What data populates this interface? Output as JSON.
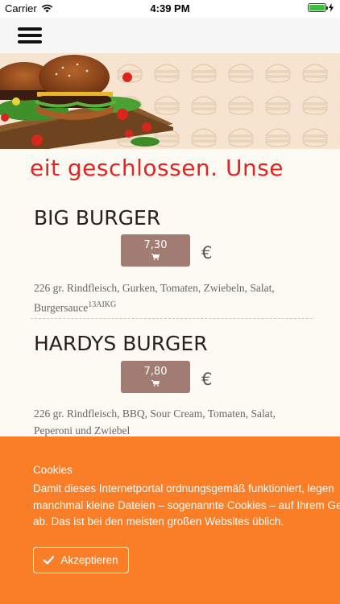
{
  "status_bar": {
    "carrier": "Carrier",
    "time": "4:39 PM"
  },
  "nav": {
    "menu_icon": "hamburger-menu-icon"
  },
  "banner": {
    "ticker_text": "eit geschlossen. Unse"
  },
  "menu_items": [
    {
      "name": "BIG BURGER",
      "price": "7,30",
      "currency": "€",
      "description": "226 gr. Rindfleisch, Gurken, Tomaten, Zwiebeln, Salat,",
      "description_line2": "Burgersauce",
      "allergens": "13AIKG"
    },
    {
      "name": "HARDYS BURGER",
      "price": "7,80",
      "currency": "€",
      "description": "226 gr. Rindfleisch, BBQ, Sour Cream, Tomaten, Salat,",
      "description_line2": "Peperoni und Zwiebel"
    }
  ],
  "cookie_banner": {
    "title": "Cookies",
    "text_line1": "Damit dieses Internetportal ordnungsgemäß funktioniert, legen",
    "text_line2": "manchmal kleine Dateien – sogenannte Cookies – auf Ihrem Ge",
    "text_line3": "ab. Das ist bei den meisten großen Websites üblich.",
    "accept_label": "Akzeptieren"
  },
  "colors": {
    "accent_red": "#e5241f",
    "price_button": "#a07c73",
    "cookie_bg": "#fa7d27"
  }
}
